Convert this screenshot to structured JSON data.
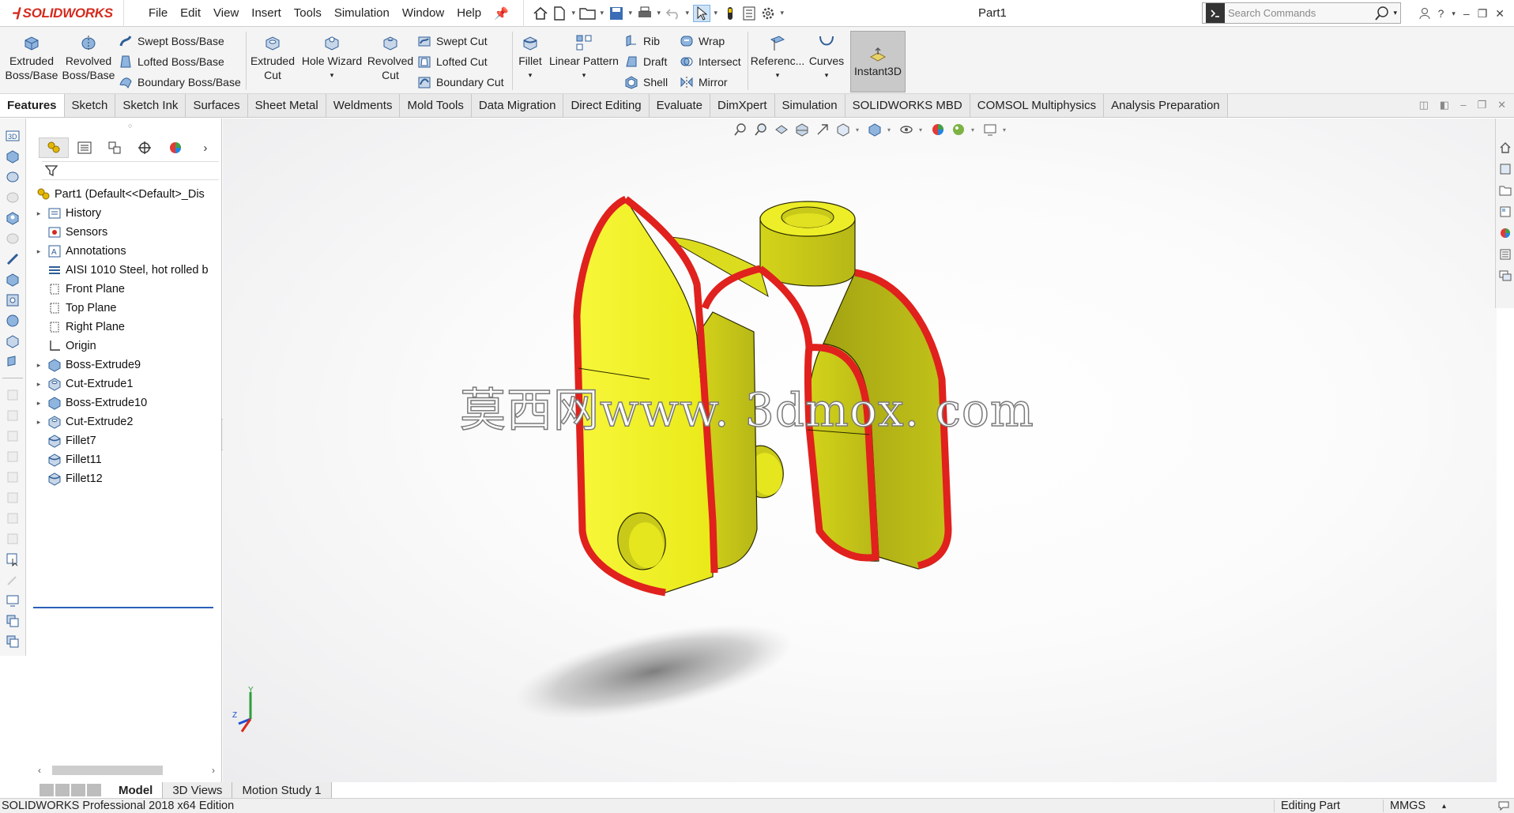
{
  "app": {
    "brand": "SOLIDWORKS",
    "doc_title": "Part1"
  },
  "menu": [
    "File",
    "Edit",
    "View",
    "Insert",
    "Tools",
    "Simulation",
    "Window",
    "Help"
  ],
  "search": {
    "placeholder": "Search Commands"
  },
  "commands": {
    "extruded_boss": "Extruded\nBoss/Base",
    "revolved_boss": "Revolved\nBoss/Base",
    "swept_boss": "Swept Boss/Base",
    "lofted_boss": "Lofted Boss/Base",
    "boundary_boss": "Boundary Boss/Base",
    "extruded_cut": "Extruded\nCut",
    "hole_wizard": "Hole Wizard",
    "revolved_cut": "Revolved\nCut",
    "swept_cut": "Swept Cut",
    "lofted_cut": "Lofted Cut",
    "boundary_cut": "Boundary Cut",
    "fillet": "Fillet",
    "linear_pattern": "Linear Pattern",
    "rib": "Rib",
    "draft": "Draft",
    "shell": "Shell",
    "wrap": "Wrap",
    "intersect": "Intersect",
    "mirror": "Mirror",
    "reference": "Referenc...",
    "curves": "Curves",
    "instant3d": "Instant3D"
  },
  "tabs": [
    "Features",
    "Sketch",
    "Sketch Ink",
    "Surfaces",
    "Sheet Metal",
    "Weldments",
    "Mold Tools",
    "Data Migration",
    "Direct Editing",
    "Evaluate",
    "DimXpert",
    "Simulation",
    "SOLIDWORKS MBD",
    "COMSOL Multiphysics",
    "Analysis Preparation"
  ],
  "tree": [
    {
      "label": "Part1  (Default<<Default>_Dis",
      "icon": "part-icon",
      "expand": ""
    },
    {
      "label": "History",
      "icon": "history-icon",
      "expand": "▸"
    },
    {
      "label": "Sensors",
      "icon": "sensors-icon",
      "expand": ""
    },
    {
      "label": "Annotations",
      "icon": "annotations-icon",
      "expand": "▸"
    },
    {
      "label": "AISI 1010 Steel, hot rolled b",
      "icon": "material-icon",
      "expand": ""
    },
    {
      "label": "Front Plane",
      "icon": "plane-icon",
      "expand": ""
    },
    {
      "label": "Top Plane",
      "icon": "plane-icon",
      "expand": ""
    },
    {
      "label": "Right Plane",
      "icon": "plane-icon",
      "expand": ""
    },
    {
      "label": "Origin",
      "icon": "origin-icon",
      "expand": ""
    },
    {
      "label": "Boss-Extrude9",
      "icon": "extrude-icon",
      "expand": "▸"
    },
    {
      "label": "Cut-Extrude1",
      "icon": "cut-icon",
      "expand": "▸"
    },
    {
      "label": "Boss-Extrude10",
      "icon": "extrude-icon",
      "expand": "▸"
    },
    {
      "label": "Cut-Extrude2",
      "icon": "cut-icon",
      "expand": "▸"
    },
    {
      "label": "Fillet7",
      "icon": "fillet-icon",
      "expand": ""
    },
    {
      "label": "Fillet11",
      "icon": "fillet-icon",
      "expand": ""
    },
    {
      "label": "Fillet12",
      "icon": "fillet-icon",
      "expand": ""
    }
  ],
  "viewport": {
    "watermark": "莫西网www. 3dmox. com",
    "triad": {
      "x": "X",
      "y": "Y",
      "z": "Z"
    }
  },
  "bottom_tabs": [
    "Model",
    "3D Views",
    "Motion Study 1"
  ],
  "status": {
    "product": "SOLIDWORKS Professional 2018 x64 Edition",
    "mode": "Editing Part",
    "units": "MMGS"
  },
  "colors": {
    "brand": "#d52b1e",
    "model_body": "#e6e619",
    "fillet_edges": "#e0211d",
    "selection": "#2b5fb8"
  }
}
